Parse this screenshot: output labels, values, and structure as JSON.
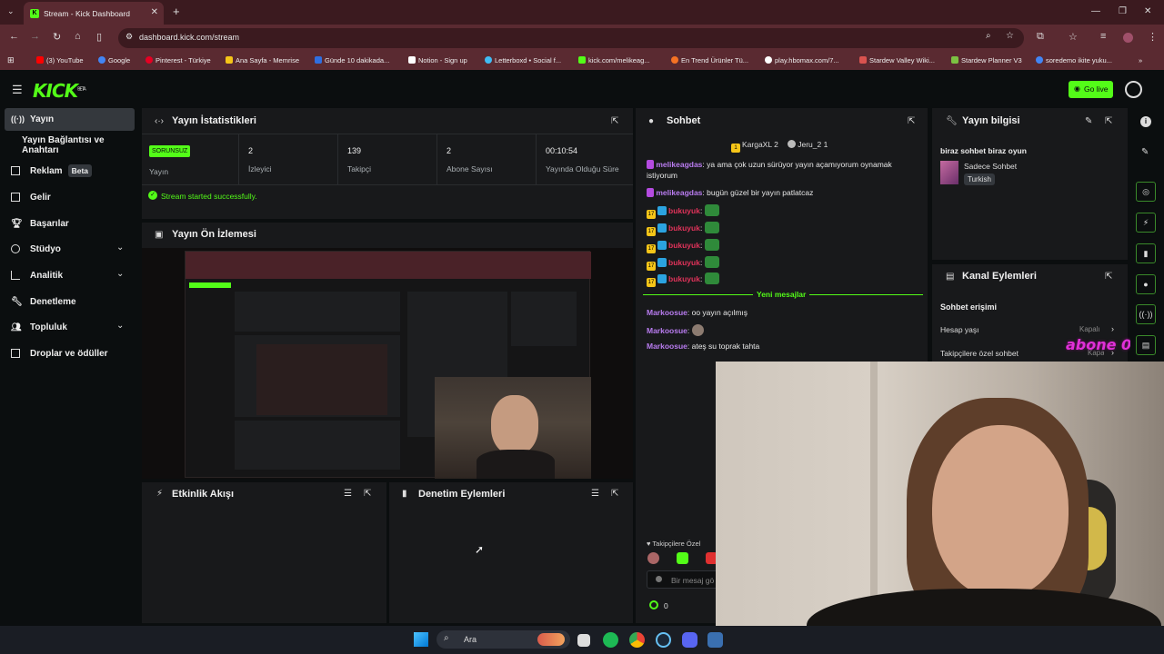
{
  "browser": {
    "tab_title": "Stream - Kick Dashboard",
    "url": "dashboard.kick.com/stream",
    "bookmarks": [
      "(3) YouTube",
      "Google",
      "Pinterest - Türkiye",
      "Ana Sayfa - Memrise",
      "Günde 10 dakikada...",
      "Notion - Sign up",
      "Letterboxd • Social f...",
      "kick.com/melikeag...",
      "En Trend Ürünler Tü...",
      "play.hbomax.com/7...",
      "Stardew Valley Wiki...",
      "Stardew Planner V3",
      "soredemo ikite yuku..."
    ]
  },
  "header": {
    "logo": "KICK",
    "beta": "BETA",
    "go_live": "Go live"
  },
  "sidebar": {
    "items": [
      {
        "label": "Yayın"
      },
      {
        "label": "Yayın Bağlantısı ve Anahtarı"
      },
      {
        "label": "Reklam",
        "badge": "Beta"
      },
      {
        "label": "Gelir"
      },
      {
        "label": "Başarılar"
      },
      {
        "label": "Stüdyo"
      },
      {
        "label": "Analitik"
      },
      {
        "label": "Denetleme"
      },
      {
        "label": "Topluluk"
      },
      {
        "label": "Droplar ve ödüller"
      }
    ]
  },
  "stats": {
    "title": "Yayın İstatistikleri",
    "status_badge": "SORUNSUZ",
    "status_label": "Yayın",
    "viewers": "2",
    "viewers_label": "İzleyici",
    "followers": "139",
    "followers_label": "Takipçi",
    "subs": "2",
    "subs_label": "Abone Sayısı",
    "uptime": "00:10:54",
    "uptime_label": "Yayında Olduğu Süre",
    "message": "Stream started successfully."
  },
  "preview": {
    "title": "Yayın Ön İzlemesi"
  },
  "activity": {
    "title": "Etkinlik Akışı"
  },
  "moderation": {
    "title": "Denetim Eylemleri"
  },
  "chat": {
    "title": "Sohbet",
    "top_users": [
      "KargaXL 2",
      "Jeru_2 1"
    ],
    "messages": [
      {
        "user": "melikeagdas",
        "text": "ya ama çok uzun sürüyor yayın açamıyorum oynamak istiyorum"
      },
      {
        "user": "melikeagdas",
        "text": "bugün güzel bir yayın patlatcaz"
      },
      {
        "user": "bukuyuk",
        "text": ""
      },
      {
        "user": "bukuyuk",
        "text": ""
      },
      {
        "user": "bukuyuk",
        "text": ""
      },
      {
        "user": "bukuyuk",
        "text": ""
      },
      {
        "user": "bukuyuk",
        "text": ""
      }
    ],
    "sub_badge": "17",
    "new_messages": "Yeni mesajlar",
    "new": [
      {
        "user": "Markoosue",
        "text": "oo yayın açılmış"
      },
      {
        "user": "Markoosue",
        "text": ""
      },
      {
        "user": "Markoosue",
        "text": "ateş su toprak tahta"
      }
    ],
    "followers_only": "Takipçilere Özel",
    "input_placeholder": "Bir mesaj gö",
    "points": "0"
  },
  "stream_info": {
    "title": "Yayın bilgisi",
    "stream_title": "biraz sohbet biraz oyun",
    "category": "Sadece Sohbet",
    "language": "Turkish"
  },
  "channel_actions": {
    "title": "Kanal Eylemleri",
    "section": "Sohbet erişimi",
    "rows": [
      {
        "label": "Hesap yaşı",
        "value": "Kapalı"
      },
      {
        "label": "Takipçilere özel sohbet",
        "value": "Kapalı"
      }
    ],
    "overlay": "abone 0 / 10"
  },
  "taskbar": {
    "search": "Ara"
  },
  "colors": {
    "accent": "#53fc18",
    "panel": "#18191b",
    "bg": "#0b0e0f",
    "chrome": "#5a2a31"
  }
}
